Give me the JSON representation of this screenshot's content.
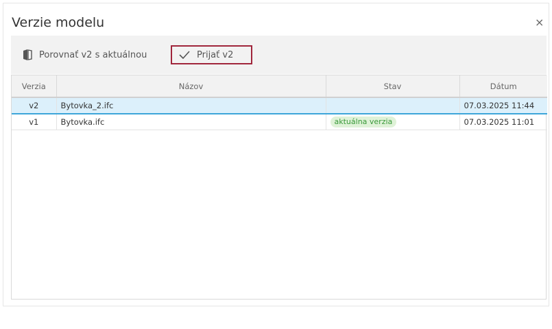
{
  "dialog": {
    "title": "Verzie modelu",
    "close_symbol": "×"
  },
  "toolbar": {
    "compare_label": "Porovnať v2 s aktuálnou",
    "compare_icon": "compare-files-icon",
    "accept_label": "Prijať v2",
    "accept_icon": "checkmark-icon",
    "accept_highlight_color": "#a0253b"
  },
  "table": {
    "headers": [
      "Verzia",
      "Názov",
      "Stav",
      "Dátum"
    ],
    "rows": [
      {
        "version": "v2",
        "name": "Bytovka_2.ifc",
        "status": "",
        "date": "07.03.2025 11:44",
        "selected": true
      },
      {
        "version": "v1",
        "name": "Bytovka.ifc",
        "status": "aktuálna verzia",
        "date": "07.03.2025 11:01",
        "selected": false
      }
    ],
    "selection_color": "#dcf0fb",
    "badge_color": "#dff2d8"
  }
}
